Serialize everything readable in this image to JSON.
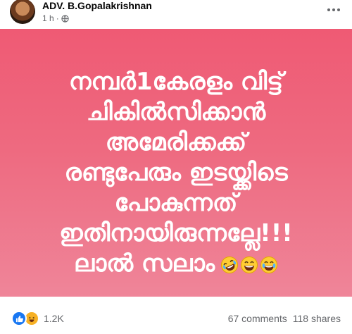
{
  "post": {
    "author": "ADV. B.Gopalakrishnan",
    "time": "1 h",
    "separator": "·",
    "privacy_icon": "globe-icon",
    "more_icon": "more-options-icon"
  },
  "image": {
    "lines": [
      "നമ്പർ1കേരളം വിട്ട്",
      "ചികിൽസിക്കാൻ",
      "അമേരിക്കക്ക്",
      "രണ്ടുപേരും ഇടയ്ക്കിടെ",
      "പോകുന്നത്",
      "ഇതിനായിരുന്നല്ലേ!!!",
      "ലാൽ സലാം"
    ],
    "emojis": [
      "rolling-laughing-emoji",
      "grinning-emoji",
      "tears-of-joy-emoji"
    ],
    "colors": {
      "background_top": "#ef5a74",
      "background_bottom": "#ef8599",
      "text": "#ffffff"
    }
  },
  "footer": {
    "reaction_icons": [
      "like-icon",
      "haha-icon"
    ],
    "reaction_count": "1.2K",
    "comments": "67 comments",
    "shares": "118 shares"
  }
}
